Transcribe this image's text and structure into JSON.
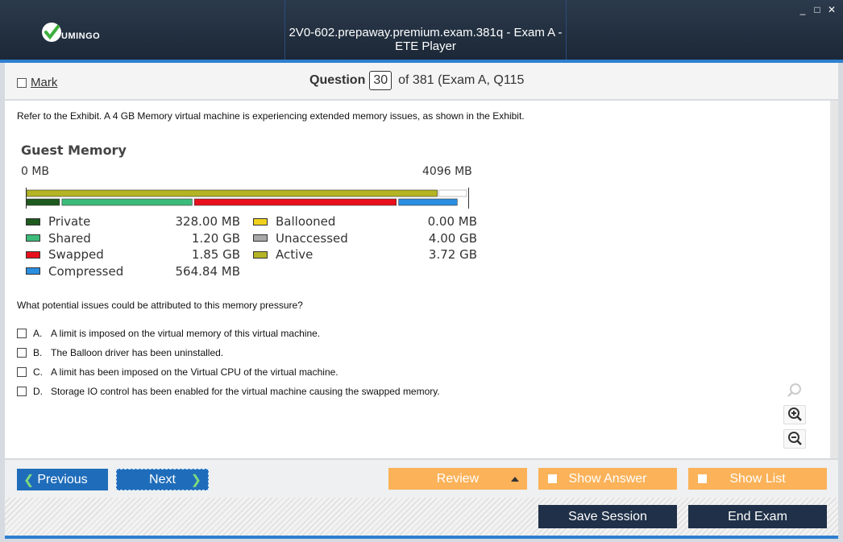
{
  "window": {
    "logo_text": "UMINGO",
    "title": "2V0-602.prepaway.premium.exam.381q - Exam A - ETE Player",
    "controls": [
      "_",
      "□",
      "✕"
    ]
  },
  "question_bar": {
    "mark_label": "Mark",
    "question_label": "Question",
    "question_number": "30",
    "of_text": "of 381 (Exam A, Q115"
  },
  "content": {
    "prompt": "Refer to the Exhibit. A 4 GB Memory virtual machine is experiencing extended memory issues, as shown in the Exhibit.",
    "question": "What potential issues could be attributed to this memory pressure?",
    "options": [
      {
        "letter": "A.",
        "text": "A limit is imposed on the virtual memory of this virtual machine."
      },
      {
        "letter": "B.",
        "text": "The Balloon driver has been uninstalled."
      },
      {
        "letter": "C.",
        "text": "A limit has been imposed on the Virtual CPU of the virtual machine."
      },
      {
        "letter": "D.",
        "text": "Storage IO control has been enabled for the virtual machine causing the swapped memory."
      }
    ]
  },
  "exhibit": {
    "title": "Guest Memory",
    "min_label": "0 MB",
    "max_label": "4096 MB",
    "total_mb": 4096,
    "active_mb": 3809,
    "segments_mb": [
      {
        "name": "Private",
        "mb": 328,
        "color": "#1e5a1e"
      },
      {
        "name": "Shared",
        "mb": 1229,
        "color": "#3dbb7a"
      },
      {
        "name": "Swapped",
        "mb": 1894,
        "color": "#e8101c"
      },
      {
        "name": "Compressed",
        "mb": 564.84,
        "color": "#2a8ee0"
      }
    ],
    "legend_left": [
      {
        "label": "Private",
        "value": "328.00 MB",
        "color": "#1e5a1e"
      },
      {
        "label": "Shared",
        "value": "1.20 GB",
        "color": "#3dbb7a"
      },
      {
        "label": "Swapped",
        "value": "1.85 GB",
        "color": "#e8101c"
      },
      {
        "label": "Compressed",
        "value": "564.84 MB",
        "color": "#2a8ee0"
      }
    ],
    "legend_right": [
      {
        "label": "Ballooned",
        "value": "0.00 MB",
        "color": "#f0d21c"
      },
      {
        "label": "Unaccessed",
        "value": "4.00 GB",
        "color": "#a8a8a8"
      },
      {
        "label": "Active",
        "value": "3.72 GB",
        "color": "#b4b424"
      }
    ]
  },
  "zoom": {
    "icons": [
      "search-icon",
      "zoom-in-icon",
      "zoom-out-icon"
    ]
  },
  "nav": {
    "previous": "Previous",
    "next": "Next",
    "review": "Review",
    "show_answer": "Show Answer",
    "show_list": "Show List",
    "save_session": "Save Session",
    "end_exam": "End Exam"
  },
  "colors": {
    "accent": "#2f7fd0",
    "nav_blue": "#1f6dba",
    "orange": "#fbb259",
    "dark": "#1f3048"
  }
}
